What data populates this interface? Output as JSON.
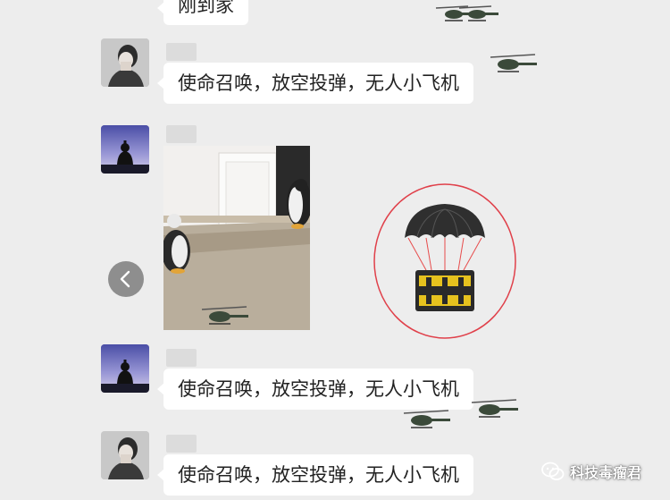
{
  "messages": [
    {
      "text": "刚到家"
    },
    {
      "text": "使命召唤，放空投弹，无人小飞机"
    },
    {
      "text": "使命召唤，放空投弹，无人小飞机"
    },
    {
      "text": "使命召唤，放空投弹，无人小飞机"
    }
  ],
  "watermark": {
    "text": "科技毒瘤君",
    "icon": "wechat-channel-icon"
  },
  "icons": {
    "back": "chevron-left-icon",
    "helicopter": "helicopter-icon",
    "airdrop": "parachute-crate-icon"
  },
  "colors": {
    "background": "#ededed",
    "bubble": "#ffffff",
    "circle": "#e0404a",
    "crate": "#e6c21e"
  }
}
